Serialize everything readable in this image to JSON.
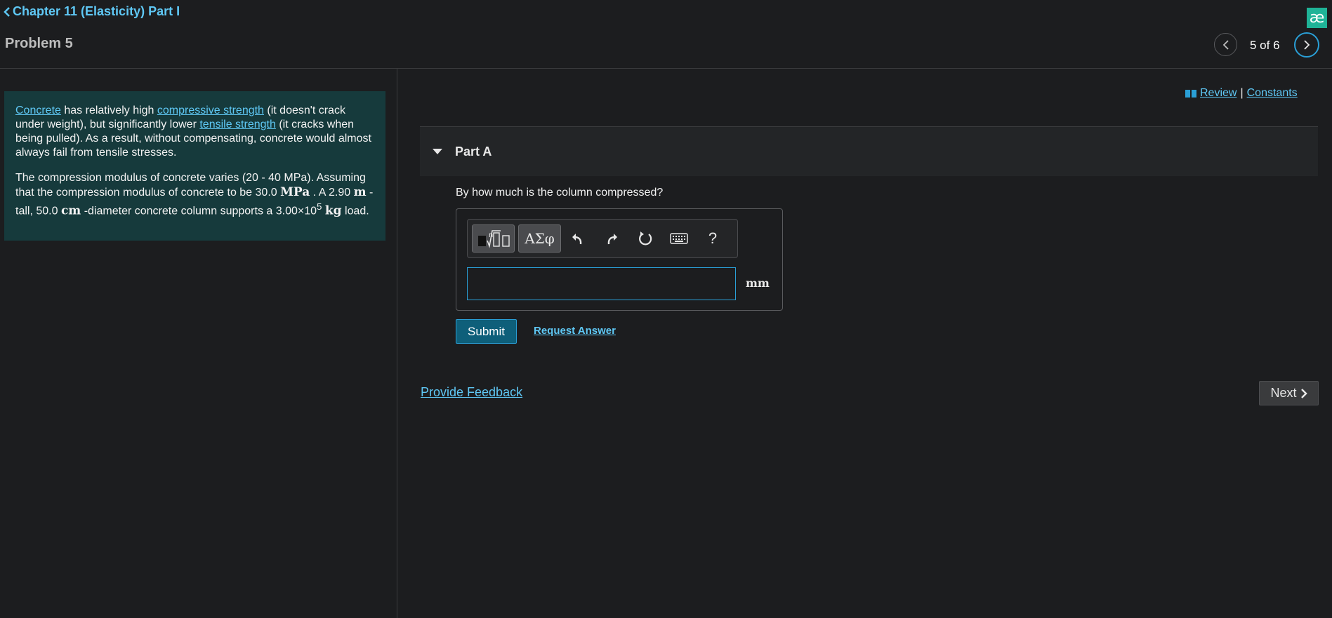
{
  "header": {
    "back_label": "Chapter 11 (Elasticity) Part I",
    "problem_title": "Problem 5",
    "brand_glyph": "æ",
    "page_indicator": "5 of 6"
  },
  "intro": {
    "p1": {
      "link1": "Concrete",
      "text1": " has relatively high ",
      "link2": "compressive strength",
      "text2": " (it doesn't crack under weight), but significantly lower ",
      "link3": "tensile strength",
      "text3": " (it cracks when being pulled). As a result, without compensating, concrete would almost always fail from tensile stresses."
    },
    "p2": {
      "t1": "The compression modulus of concrete varies (20 - 40 MPa). Assuming that the compression modulus of concrete to be 30.0 ",
      "u1": "MPa",
      "t2": " . A 2.90 ",
      "u2": "m",
      "t3": " -tall, 50.0 ",
      "u3": "cm",
      "t4": " -diameter concrete column supports a 3.00×10",
      "exp": "5",
      "t5": " ",
      "u4": "kg",
      "t6": " load."
    }
  },
  "links": {
    "review": "Review",
    "separator": "|",
    "constants": "Constants"
  },
  "part": {
    "title": "Part A",
    "question": "By how much is the column compressed?",
    "answer_value": "",
    "unit": "mm"
  },
  "toolbar": {
    "greek_label": "ΑΣφ",
    "help_label": "?"
  },
  "actions": {
    "submit_label": "Submit",
    "request_answer_label": "Request Answer",
    "feedback_label": "Provide Feedback",
    "next_label": "Next"
  },
  "colors": {
    "background": "#1c1d1f",
    "accent": "#5fc8f5",
    "intro_bg": "#163a3c",
    "brand": "#1fb397",
    "submit_bg": "#0e5f7a"
  }
}
